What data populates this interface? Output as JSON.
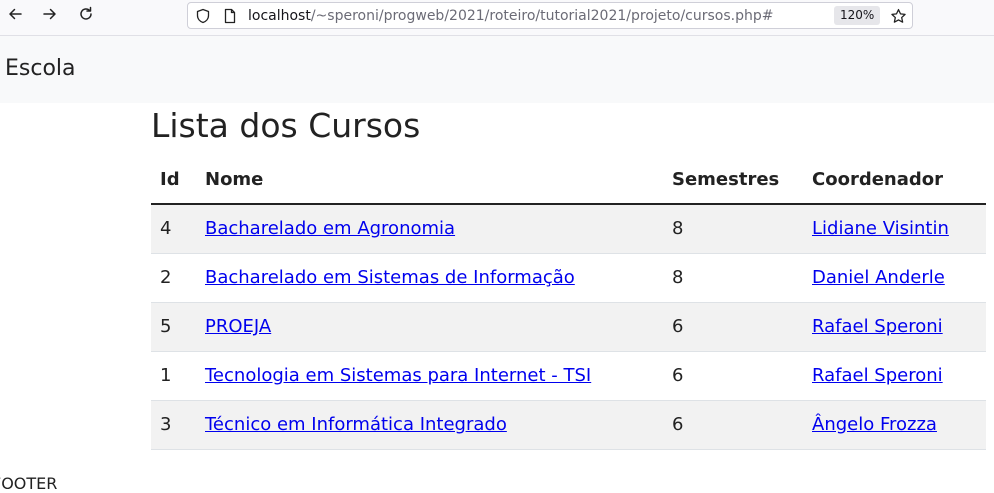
{
  "browser": {
    "url_host": "localhost",
    "url_path": "/~speroni/progweb/2021/roteiro/tutorial2021/projeto/cursos.php#",
    "zoom": "120%"
  },
  "navbar": {
    "brand": "Escola"
  },
  "page": {
    "title": "Lista dos Cursos"
  },
  "table": {
    "headers": {
      "id": "Id",
      "name": "Nome",
      "semesters": "Semestres",
      "coordinator": "Coordenador"
    },
    "rows": [
      {
        "id": "4",
        "name": "Bacharelado em Agronomia",
        "semesters": "8",
        "coordinator": "Lidiane Visintin"
      },
      {
        "id": "2",
        "name": "Bacharelado em Sistemas de Informação",
        "semesters": "8",
        "coordinator": "Daniel Anderle"
      },
      {
        "id": "5",
        "name": "PROEJA",
        "semesters": "6",
        "coordinator": "Rafael Speroni"
      },
      {
        "id": "1",
        "name": "Tecnologia em Sistemas para Internet - TSI",
        "semesters": "6",
        "coordinator": "Rafael Speroni"
      },
      {
        "id": "3",
        "name": "Técnico em Informática Integrado",
        "semesters": "6",
        "coordinator": "Ângelo Frozza"
      }
    ]
  },
  "footer": {
    "text": "FOOTER"
  },
  "icons": {
    "back": "arrow-left-icon",
    "forward": "arrow-right-icon",
    "reload": "reload-icon",
    "shield": "shield-icon",
    "page": "page-icon",
    "bookmark": "star-icon"
  },
  "colors": {
    "link": "#0000ee",
    "navbar_bg": "#f8f9fa",
    "row_stripe": "#f2f2f2"
  }
}
